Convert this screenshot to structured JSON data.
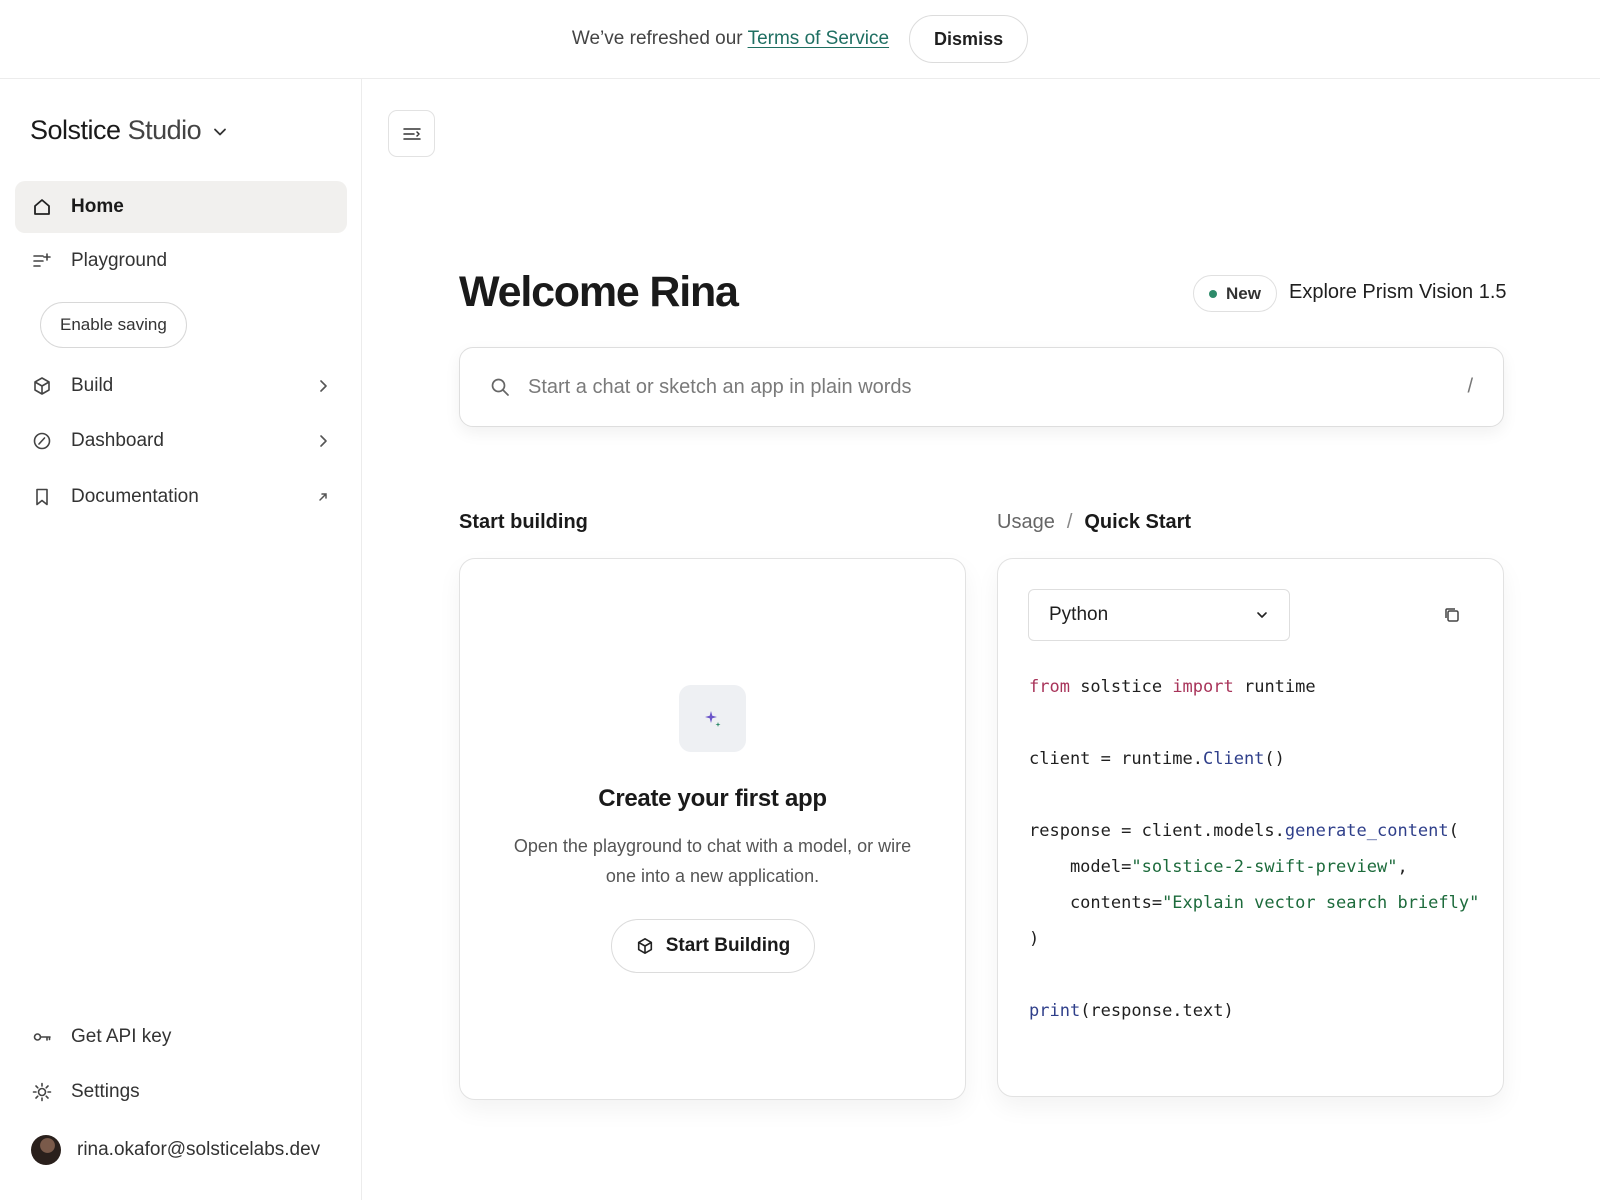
{
  "banner": {
    "text": "We’ve refreshed our ",
    "link": "Terms of Service",
    "dismiss_label": "Dismiss"
  },
  "sidebar": {
    "brand_name": "Solstice",
    "brand_suffix": "Studio",
    "items": [
      {
        "label": "Home",
        "icon": "home-icon",
        "active": true
      },
      {
        "label": "Playground",
        "icon": "playground-icon"
      },
      {
        "label": "Build",
        "icon": "cube-icon",
        "trailing": "chevron-right-icon"
      },
      {
        "label": "Dashboard",
        "icon": "gauge-icon",
        "trailing": "chevron-right-icon"
      },
      {
        "label": "Documentation",
        "icon": "bookmark-icon",
        "trailing": "external-link-icon"
      }
    ],
    "enable_saving_label": "Enable saving",
    "bottom": [
      {
        "label": "Get API key",
        "icon": "key-icon"
      },
      {
        "label": "Settings",
        "icon": "gear-icon"
      }
    ],
    "user_email": "rina.okafor@solsticelabs.dev"
  },
  "main": {
    "welcome": "Welcome Rina",
    "new_badge": "New",
    "explore_text": "Explore Prism Vision 1.5",
    "search": {
      "placeholder": "Start a chat or sketch an app in plain words",
      "shortcut": "/"
    },
    "start_building_title": "Start building",
    "breadcrumb": {
      "usage": "Usage",
      "separator": "/",
      "current": "Quick Start"
    },
    "create_card": {
      "heading": "Create your first app",
      "description": "Open the playground to chat with a model, or wire one into a new application.",
      "button": "Start Building"
    },
    "code_card": {
      "language": "Python",
      "lines": [
        "from solstice import runtime",
        "",
        "client = runtime.Client()",
        "",
        "response = client.models.generate_content(",
        "    model=\"solstice-2-swift-preview\",",
        "    contents=\"Explain vector search briefly\"",
        ")",
        "",
        "print(response.text)"
      ]
    }
  },
  "colors": {
    "accent_link": "#1f6f62",
    "new_dot": "#2e8b6a",
    "code_keyword": "#a8345a",
    "code_function": "#2f3f8a",
    "code_string": "#1d6b3c"
  }
}
